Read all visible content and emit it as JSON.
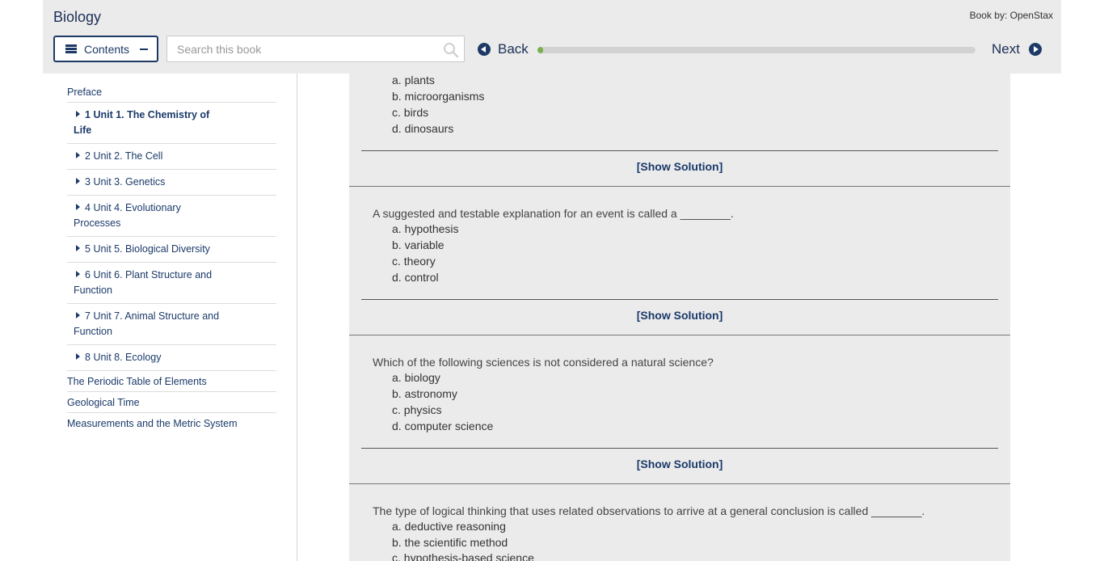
{
  "header": {
    "book_title": "Biology",
    "book_by": "Book by: OpenStax",
    "contents_label": "Contents",
    "search_placeholder": "Search this book",
    "back_label": "Back",
    "next_label": "Next",
    "progress_fraction": 0.01,
    "accent": "#1d3966",
    "progress_color": "#78b04a"
  },
  "sidebar": {
    "preface": "Preface",
    "units": [
      {
        "num": "1",
        "line1": "Unit 1. The Chemistry of",
        "line2": "Life",
        "bold": true
      },
      {
        "num": "2",
        "line1": "Unit 2. The Cell",
        "line2": ""
      },
      {
        "num": "3",
        "line1": "Unit 3. Genetics",
        "line2": ""
      },
      {
        "num": "4",
        "line1": "Unit 4. Evolutionary",
        "line2": "Processes"
      },
      {
        "num": "5",
        "line1": "Unit 5. Biological Diversity",
        "line2": ""
      },
      {
        "num": "6",
        "line1": "Unit 6. Plant Structure and",
        "line2": "Function"
      },
      {
        "num": "7",
        "line1": "Unit 7. Animal Structure and",
        "line2": "Function"
      },
      {
        "num": "8",
        "line1": "Unit 8. Ecology",
        "line2": ""
      }
    ],
    "appendices": [
      "The Periodic Table of Elements",
      "Geological Time",
      "Measurements and the Metric System"
    ]
  },
  "main": {
    "show_solution": "[Show Solution]",
    "q0_options": [
      "a. plants",
      "b. microorganisms",
      "c. birds",
      "d. dinosaurs"
    ],
    "questions": [
      {
        "text": "A suggested and testable explanation for an event is called a ________.",
        "options": [
          "a. hypothesis",
          "b. variable",
          "c. theory",
          "d. control"
        ]
      },
      {
        "text": "Which of the following sciences is not considered a natural science?",
        "options": [
          "a. biology",
          "b. astronomy",
          "c. physics",
          "d. computer science"
        ]
      },
      {
        "text": "The type of logical thinking that uses related observations to arrive at a general conclusion is called ________.",
        "options": [
          "a. deductive reasoning",
          "b. the scientific method",
          "c. hypothesis-based science"
        ]
      }
    ]
  }
}
